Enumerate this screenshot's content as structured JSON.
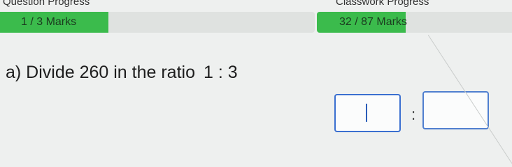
{
  "progress": {
    "question_label": "Question Progress",
    "question_value": "1 / 3 Marks",
    "question_fraction": 0.333,
    "classwork_label": "Classwork Progress",
    "classwork_value": "32 / 87 Marks",
    "classwork_fraction": 0.368
  },
  "question": {
    "text": "a) Divide 260 in the ratio",
    "ratio": "1 : 3"
  },
  "answer": {
    "separator": ":",
    "first_value": "",
    "second_value": ""
  },
  "colors": {
    "progress_fill": "#3bbb4c",
    "input_border": "#3a6fd0"
  }
}
